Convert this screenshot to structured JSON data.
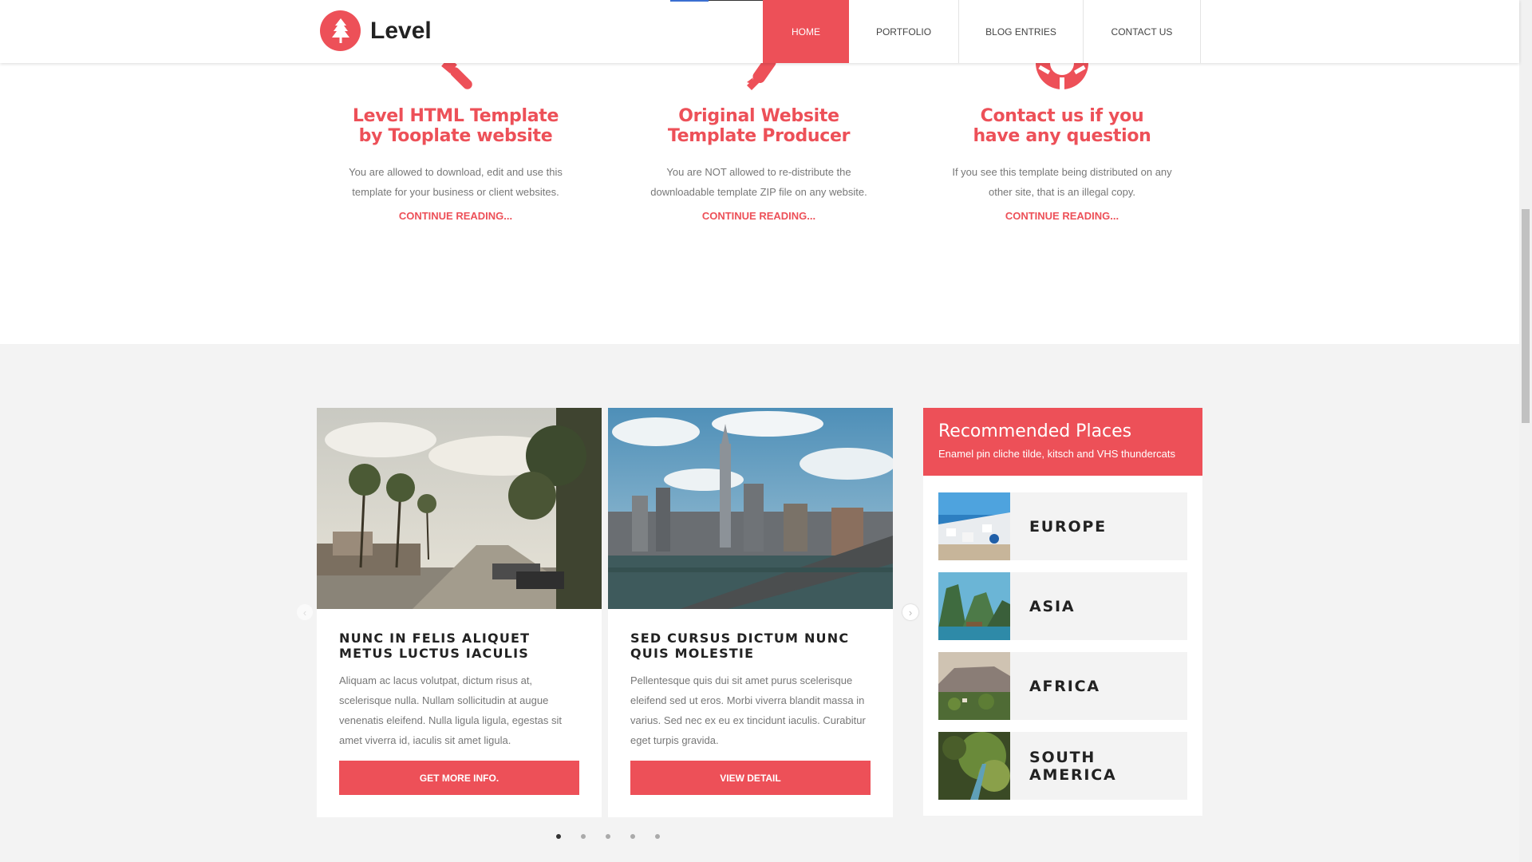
{
  "brand": {
    "name": "Level",
    "logo_icon": "tree-icon",
    "accent_color": "#ed5058"
  },
  "nav": {
    "items": [
      {
        "label": "HOME",
        "active": true
      },
      {
        "label": "PORTFOLIO",
        "active": false
      },
      {
        "label": "BLOG ENTRIES",
        "active": false
      },
      {
        "label": "CONTACT US",
        "active": false
      }
    ]
  },
  "features": [
    {
      "icon": "tools-icon",
      "title": "Level HTML Template by Tooplate website",
      "text": "You are allowed to download, edit and use this template for your business or client websites.",
      "link": "CONTINUE READING..."
    },
    {
      "icon": "rocket-icon",
      "title": "Original Website Template Producer",
      "text": "You are NOT allowed to re-distribute the downloadable template ZIP file on any website.",
      "link": "CONTINUE READING..."
    },
    {
      "icon": "lifebuoy-icon",
      "title": "Contact us if you have any question",
      "text": "If you see this template being distributed on any other site, that is an illegal copy.",
      "link": "CONTINUE READING..."
    }
  ],
  "cards": [
    {
      "image": "palm-street-photo",
      "title": "NUNC IN FELIS ALIQUET METUS LUCTUS IACULIS",
      "text": "Aliquam ac lacus volutpat, dictum risus at, scelerisque nulla. Nullam sollicitudin at augue venenatis eleifend. Nulla ligula ligula, egestas sit amet viverra id, iaculis sit amet ligula.",
      "button": "GET MORE INFO."
    },
    {
      "image": "city-skyline-photo",
      "title": "SED CURSUS DICTUM NUNC QUIS MOLESTIE",
      "text": "Pellentesque quis dui sit amet purus scelerisque eleifend sed ut eros. Morbi viverra blandit massa in varius. Sed nec ex eu ex tincidunt iaculis. Curabitur eget turpis gravida.",
      "button": "VIEW DETAIL"
    }
  ],
  "slider": {
    "prev_icon": "chevron-left-icon",
    "next_icon": "chevron-right-icon",
    "dot_count": 5,
    "active_dot": 0
  },
  "recommended": {
    "title": "Recommended Places",
    "subtitle": "Enamel pin cliche tilde, kitsch and VHS thundercats",
    "places": [
      {
        "name": "EUROPE",
        "image": "santorini-photo"
      },
      {
        "name": "ASIA",
        "image": "halong-bay-photo"
      },
      {
        "name": "AFRICA",
        "image": "table-mountain-photo"
      },
      {
        "name": "SOUTH AMERICA",
        "image": "jungle-waterfall-photo"
      }
    ]
  }
}
